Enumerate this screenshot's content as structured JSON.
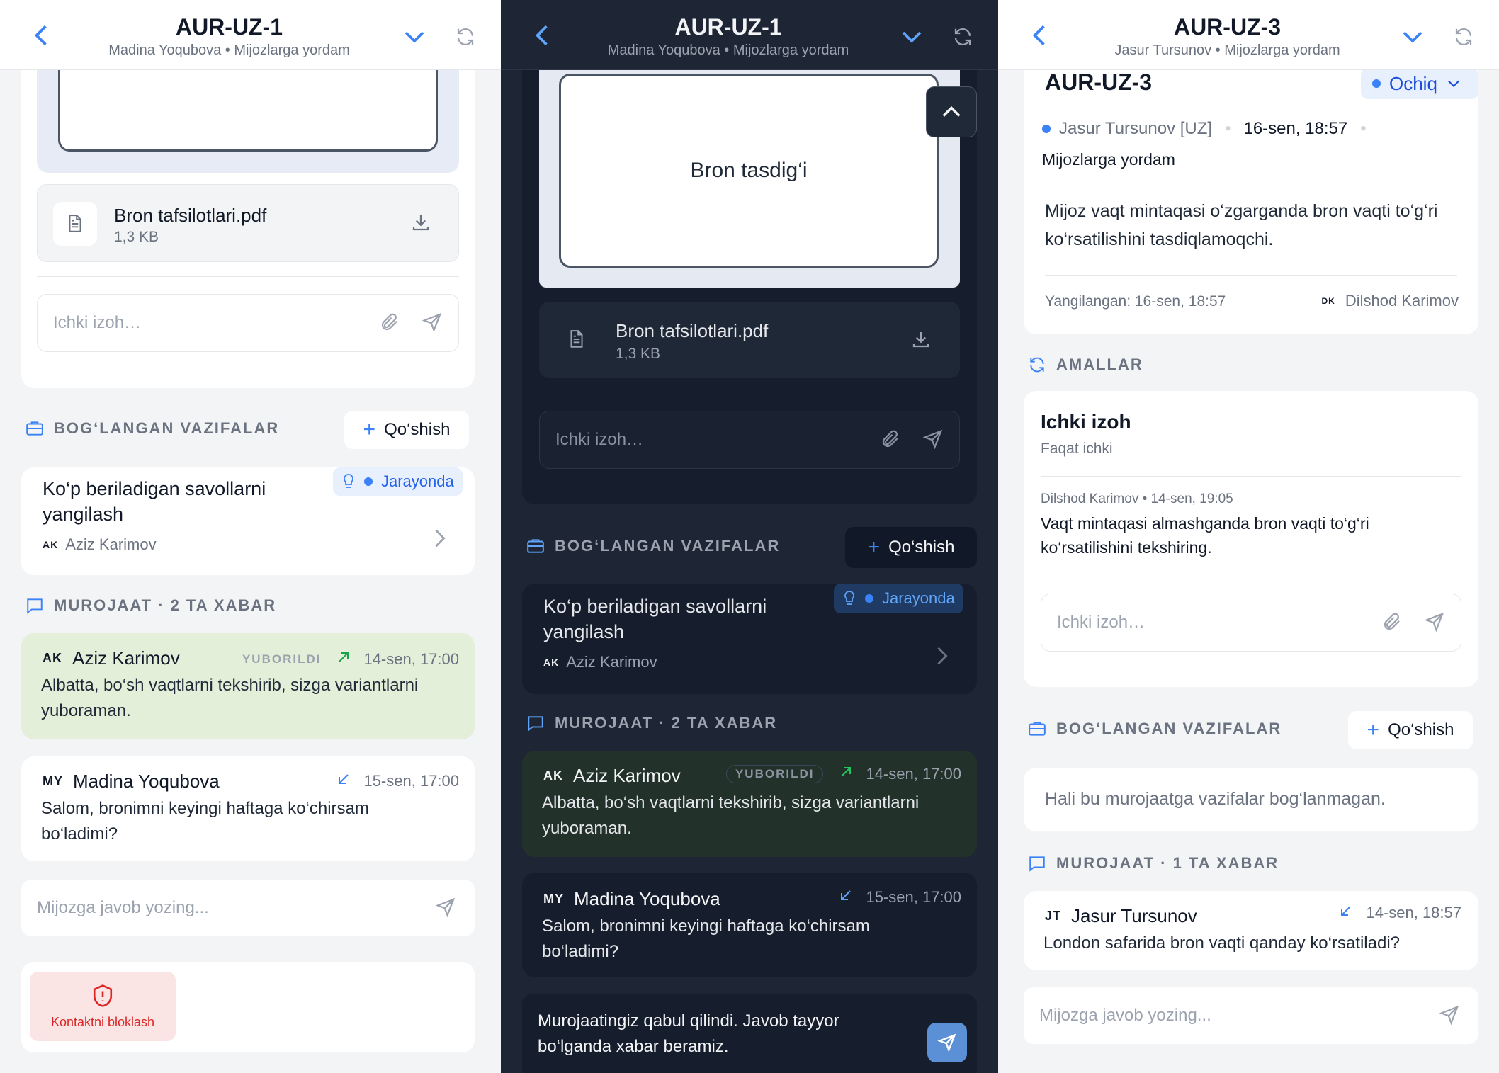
{
  "colors": {
    "accent": "#3b82f6",
    "sent_bubble": "#e3efd8",
    "danger": "#dc2626",
    "dark_bg": "#1e2635"
  },
  "panels": [
    {
      "header": {
        "title": "AUR-UZ-1",
        "subtitle": "Madina Yoqubova • Mijozlarga yordam"
      },
      "attachment": {
        "name": "Bron tafsilotlari.pdf",
        "size": "1,3 KB"
      },
      "note_placeholder": "Ichki izoh…",
      "linked": {
        "label": "BOG‘LANGAN VAZIFALAR",
        "add": "Qo‘shish",
        "task": {
          "title": "Ko‘p beriladigan savollarni yangilash",
          "status": "Jarayonda",
          "initials": "AK",
          "assignee": "Aziz Karimov"
        }
      },
      "conv": {
        "label": "MUROJAAT · 2 TA XABAR"
      },
      "messages": [
        {
          "initials": "AK",
          "name": "Aziz Karimov",
          "sent_label": "YUBORILDI",
          "time": "14-sen, 17:00",
          "text": "Albatta, bo‘sh vaqtlarni tekshirib, sizga variantlarni yuboraman."
        },
        {
          "initials": "MY",
          "name": "Madina Yoqubova",
          "time": "15-sen, 17:00",
          "text": "Salom, bronimni keyingi haftaga ko‘chirsam bo‘ladimi?"
        }
      ],
      "reply_placeholder": "Mijozga javob yozing...",
      "block_label": "Kontaktni bloklash"
    },
    {
      "header": {
        "title": "AUR-UZ-1",
        "subtitle": "Madina Yoqubova • Mijozlarga yordam"
      },
      "preview_text": "Bron tasdig‘i",
      "attachment": {
        "name": "Bron tafsilotlari.pdf",
        "size": "1,3 KB"
      },
      "note_placeholder": "Ichki izoh…",
      "linked": {
        "label": "BOG‘LANGAN VAZIFALAR",
        "add": "Qo‘shish",
        "task": {
          "title": "Ko‘p beriladigan savollarni yangilash",
          "status": "Jarayonda",
          "initials": "AK",
          "assignee": "Aziz Karimov"
        }
      },
      "conv": {
        "label": "MUROJAAT · 2 TA XABAR"
      },
      "messages": [
        {
          "initials": "AK",
          "name": "Aziz Karimov",
          "sent_label": "YUBORILDI",
          "time": "14-sen, 17:00",
          "text": "Albatta, bo‘sh vaqtlarni tekshirib, sizga variantlarni yuboraman."
        },
        {
          "initials": "MY",
          "name": "Madina Yoqubova",
          "time": "15-sen, 17:00",
          "text": "Salom, bronimni keyingi haftaga ko‘chirsam bo‘ladimi?"
        }
      ],
      "reply_text": "Murojaatingiz qabul qilindi. Javob tayyor bo‘lganda xabar beramiz."
    },
    {
      "header": {
        "title": "AUR-UZ-3",
        "subtitle": "Jasur Tursunov • Mijozlarga yordam"
      },
      "ticket": {
        "id": "AUR-UZ-3",
        "status": "Ochiq",
        "customer": "Jasur Tursunov [UZ]",
        "datetime": "16-sen, 18:57",
        "team": "Mijozlarga yordam",
        "description": "Mijoz vaqt mintaqasi o‘zgarganda bron vaqti to‘g‘ri ko‘rsatilishini tasdiqlamoqchi.",
        "updated": "Yangilangan: 16-sen, 18:57",
        "assignee_initials": "DK",
        "assignee": "Dilshod Karimov"
      },
      "actions_label": "AMALLAR",
      "internal": {
        "title": "Ichki izoh",
        "subtitle": "Faqat ichki",
        "note_meta": "Dilshod Karimov • 14-sen, 19:05",
        "note_text": "Vaqt mintaqasi almashganda bron vaqti to‘g‘ri ko‘rsatilishini tekshiring.",
        "placeholder": "Ichki izoh…"
      },
      "linked": {
        "label": "BOG‘LANGAN VAZIFALAR",
        "add": "Qo‘shish",
        "empty": "Hali bu murojaatga vazifalar bog‘lanmagan."
      },
      "conv": {
        "label": "MUROJAAT · 1 TA XABAR"
      },
      "messages": [
        {
          "initials": "JT",
          "name": "Jasur Tursunov",
          "time": "14-sen, 18:57",
          "text": "London safarida bron vaqti qanday ko‘rsatiladi?"
        }
      ],
      "reply_placeholder": "Mijozga javob yozing..."
    }
  ]
}
